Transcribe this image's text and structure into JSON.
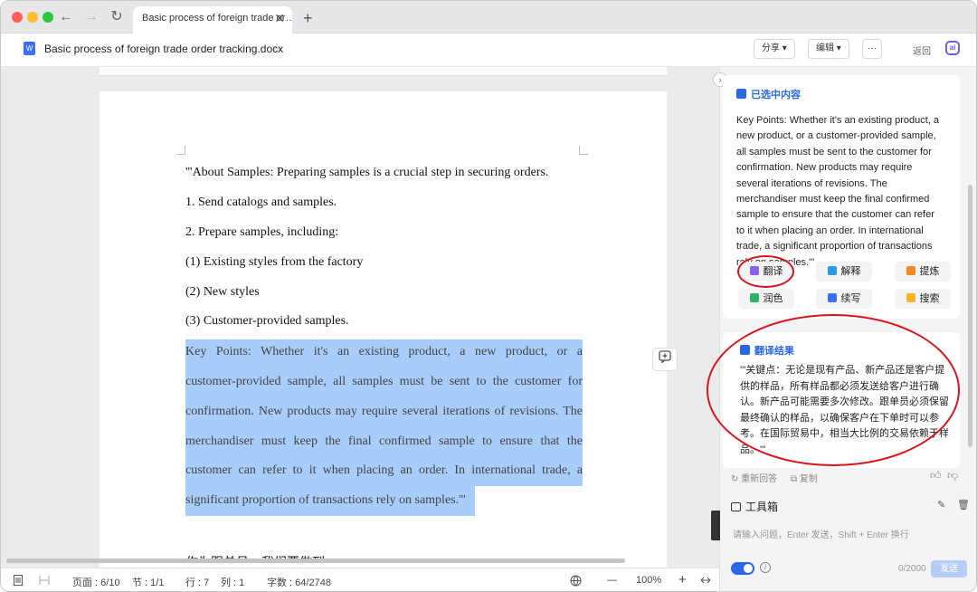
{
  "browser": {
    "tab_title": "Basic process of foreign trade or…",
    "tab_close": "✕",
    "new_tab": "+",
    "nav_back": "←",
    "nav_forward": "→",
    "nav_reload": "↻"
  },
  "toolbar": {
    "doc_icon": "W",
    "doc_title": "Basic process of foreign trade order tracking.docx",
    "star": "☆",
    "share_label": "分享 ▾",
    "edit_label": "编辑 ▾",
    "more_label": "···",
    "back_label": "返回",
    "ai_label": "ai"
  },
  "document": {
    "paragraphs": [
      "'''About Samples: Preparing samples is a crucial step in securing orders.",
      "1. Send catalogs and samples.",
      "2. Prepare samples, including:",
      "(1) Existing styles from the factory",
      "(2) New styles",
      "(3) Customer-provided samples."
    ],
    "highlighted_lines": [
      "Key Points: Whether it's an existing product, a new product, or a",
      "customer-provided sample, all samples must be sent to the customer for",
      "confirmation. New products may require several iterations of revisions. The",
      "merchandiser must keep the final confirmed sample to ensure that the",
      "customer can refer to it when placing an order. In international trade, a",
      "significant proportion of transactions rely on samples.'''"
    ],
    "cutoff_line": "作为跟单员，我们要做到…"
  },
  "statusbar": {
    "page": "页面 : 6/10",
    "section": "节 : 1/1",
    "row": "行 : 7",
    "col": "列 : 1",
    "words": "字数 : 64/2748",
    "zoom": "100%",
    "zoom_out": "—",
    "zoom_in": "+"
  },
  "sidebar": {
    "collapse": "›",
    "selected_title": "已选中内容",
    "selected_text": "Key Points: Whether it's an existing product, a new product, or a customer-provided sample, all samples must be sent to the customer for confirmation. New products may require several iterations of revisions. The merchandiser must keep the final confirmed sample to ensure that the customer can refer to it when placing an order. In international trade, a significant proportion of transactions rely on samples.'''",
    "actions": [
      {
        "label": "翻译",
        "color": "#8a63e6"
      },
      {
        "label": "解释",
        "color": "#2b9be8"
      },
      {
        "label": "提炼",
        "color": "#f08a24"
      },
      {
        "label": "润色",
        "color": "#2fb36b"
      },
      {
        "label": "续写",
        "color": "#3b6ff5"
      },
      {
        "label": "搜索",
        "color": "#f5b524"
      }
    ],
    "result_title": "翻译结果",
    "result_text": "'''关键点：无论是现有产品、新产品还是客户提供的样品，所有样品都必须发送给客户进行确认。新产品可能需要多次修改。跟单员必须保留最终确认的样品，以确保客户在下单时可以参考。在国际贸易中，相当大比例的交易依赖于样品。'''",
    "regenerate": "重新回答",
    "copy": "复制",
    "toolbox": "工具箱",
    "input_placeholder": "请输入问题，Enter 发送，Shift + Enter 换行",
    "char_count": "0/2000",
    "send": "发送"
  },
  "colors": {
    "accent": "#2b68e8",
    "highlight": "#a8cdfb",
    "annotation": "#d9141c"
  }
}
